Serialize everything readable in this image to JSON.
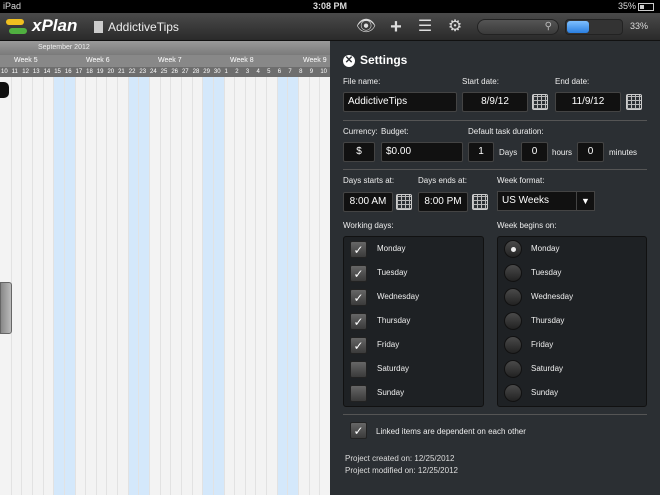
{
  "status_bar": {
    "device": "iPad",
    "time": "3:08 PM",
    "battery": "35%"
  },
  "toolbar": {
    "app_title": "xPlan",
    "doc_title": "AddictiveTips",
    "zoom_label": "33%",
    "zoom_level": 0.4
  },
  "gantt": {
    "month": "September 2012",
    "weeks": [
      "Week 5",
      "Week 6",
      "Week 7",
      "Week 8",
      "Week 9"
    ],
    "days": [
      "10",
      "11",
      "12",
      "13",
      "14",
      "15",
      "16",
      "17",
      "18",
      "19",
      "20",
      "21",
      "22",
      "23",
      "24",
      "25",
      "26",
      "27",
      "28",
      "29",
      "30",
      "1",
      "2",
      "3",
      "4",
      "5",
      "6",
      "7",
      "8",
      "9",
      "10"
    ]
  },
  "settings": {
    "title": "Settings",
    "file_name_label": "File name:",
    "file_name": "AddictiveTips",
    "start_date_label": "Start date:",
    "start_date": "8/9/12",
    "end_date_label": "End date:",
    "end_date": "11/9/12",
    "currency_label": "Currency:",
    "currency": "$",
    "budget_label": "Budget:",
    "budget": "$0.00",
    "duration_label": "Default task duration:",
    "duration_days": "1",
    "days_unit": "Days",
    "duration_hours": "0",
    "hours_unit": "hours",
    "duration_minutes": "0",
    "minutes_unit": "minutes",
    "day_start_label": "Days starts at:",
    "day_start": "8:00 AM",
    "day_end_label": "Days ends at:",
    "day_end": "8:00 PM",
    "week_format_label": "Week format:",
    "week_format": "US Weeks",
    "working_days_label": "Working days:",
    "working_days": [
      {
        "label": "Monday",
        "checked": true
      },
      {
        "label": "Tuesday",
        "checked": true
      },
      {
        "label": "Wednesday",
        "checked": true
      },
      {
        "label": "Thursday",
        "checked": true
      },
      {
        "label": "Friday",
        "checked": true
      },
      {
        "label": "Saturday",
        "checked": false
      },
      {
        "label": "Sunday",
        "checked": false
      }
    ],
    "week_begins_label": "Week begins on:",
    "week_begins": [
      {
        "label": "Monday",
        "selected": true
      },
      {
        "label": "Tuesday",
        "selected": false
      },
      {
        "label": "Wednesday",
        "selected": false
      },
      {
        "label": "Thursday",
        "selected": false
      },
      {
        "label": "Friday",
        "selected": false
      },
      {
        "label": "Saturday",
        "selected": false
      },
      {
        "label": "Sunday",
        "selected": false
      }
    ],
    "linked_label": "Linked items are dependent on each other",
    "created": "Project created on: 12/25/2012",
    "modified": "Project modified on: 12/25/2012"
  },
  "colors": {
    "accent_blue": "#2a7fe0",
    "weekend": "#d4e8fb",
    "panel_bg": "#2b2f33"
  }
}
